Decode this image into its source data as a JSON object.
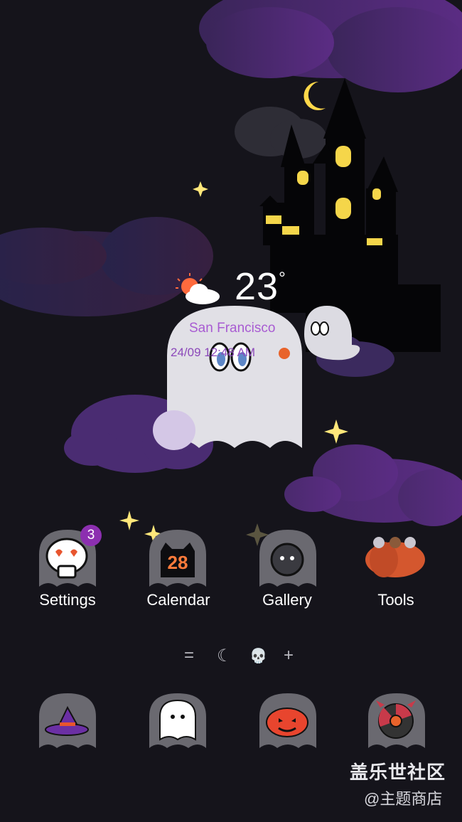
{
  "weather": {
    "temperature": "23",
    "degree": "°",
    "city": "San Francisco",
    "datetime": "24/09 12:48 AM",
    "icon": "partly-sunny-icon"
  },
  "apps": [
    {
      "label": "Settings",
      "icon": "skull-icon",
      "badge": "3"
    },
    {
      "label": "Calendar",
      "icon": "cat-calendar-icon",
      "date": "28"
    },
    {
      "label": "Gallery",
      "icon": "dust-bunny-icon"
    },
    {
      "label": "Tools",
      "icon": "pumpkin-tools-icon"
    }
  ],
  "pager": {
    "items": [
      "=",
      "☾",
      "💀",
      "+"
    ]
  },
  "dock": [
    {
      "icon": "witch-hat-icon"
    },
    {
      "icon": "ghost-icon"
    },
    {
      "icon": "jack-o-lantern-icon"
    },
    {
      "icon": "devil-ball-icon"
    }
  ],
  "watermark": {
    "line1": "盖乐世社区",
    "line2": "@主题商店"
  },
  "colors": {
    "background": "#15141b",
    "cloud_purple": "#5b2c84",
    "accent_text": "#a85bd2",
    "moon": "#ffd84a"
  }
}
